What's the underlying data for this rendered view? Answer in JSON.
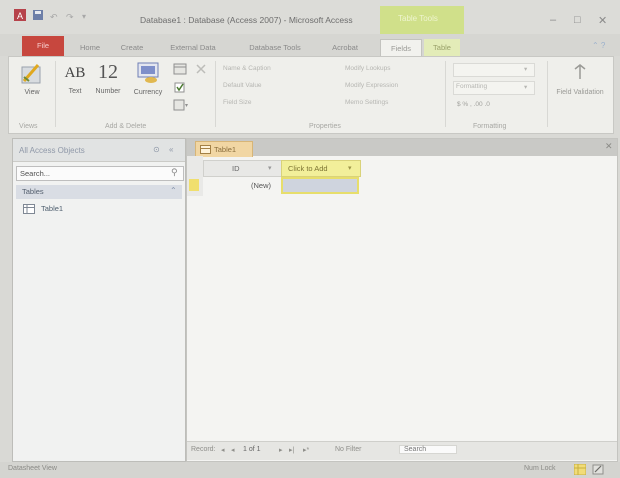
{
  "window": {
    "title": "Database1 : Database (Access 2007) - Microsoft Access",
    "contextual_group": "Table Tools",
    "controls": [
      "–",
      "□",
      "✕"
    ]
  },
  "ribbon_tabs": [
    {
      "label": "File",
      "active": false
    },
    {
      "label": "Home",
      "active": false
    },
    {
      "label": "Create",
      "active": false
    },
    {
      "label": "External Data",
      "active": false
    },
    {
      "label": "Database Tools",
      "active": false
    },
    {
      "label": "Acrobat",
      "active": false
    },
    {
      "label": "Fields",
      "active": true
    },
    {
      "label": "Table",
      "active": false
    }
  ],
  "ribbon": {
    "views": {
      "view_label": "View",
      "group_label": "Views"
    },
    "add_delete": {
      "text_label": "Text",
      "text_glyph": "AB",
      "number_label": "Number",
      "number_glyph": "12",
      "currency_label": "Currency",
      "group_label": "Add & Delete"
    },
    "properties": {
      "name_caption": "Name & Caption",
      "default_value": "Default Value",
      "field_size": "Field Size",
      "modify_lookups": "Modify Lookups",
      "modify_expression": "Modify Expression",
      "memo_settings": "Memo Settings",
      "group_label": "Properties"
    },
    "formatting": {
      "data_type": "",
      "format": "Formatting",
      "number_format": "$  %  ,  .00 .0",
      "group_label": "Formatting"
    },
    "validation": {
      "label": "Field Validation"
    }
  },
  "nav_pane": {
    "header": "All Access Objects",
    "search_placeholder": "Search...",
    "group": "Tables",
    "items": [
      {
        "label": "Table1"
      }
    ]
  },
  "document": {
    "tab_label": "Table1",
    "columns": [
      {
        "header": "ID"
      },
      {
        "header": "Click to Add"
      }
    ],
    "new_row_label": "(New)",
    "record_nav": {
      "record_label": "Record:",
      "position": "1 of 1",
      "filter_label": "No Filter",
      "search_label": "Search"
    }
  },
  "status": {
    "left": "Datasheet View",
    "num_lock": "Num Lock"
  },
  "colors": {
    "file_tab": "#c7473e",
    "contextual": "#d0e08a",
    "highlight": "#f2ef9a",
    "doc_tab": "#f1d6a3"
  }
}
